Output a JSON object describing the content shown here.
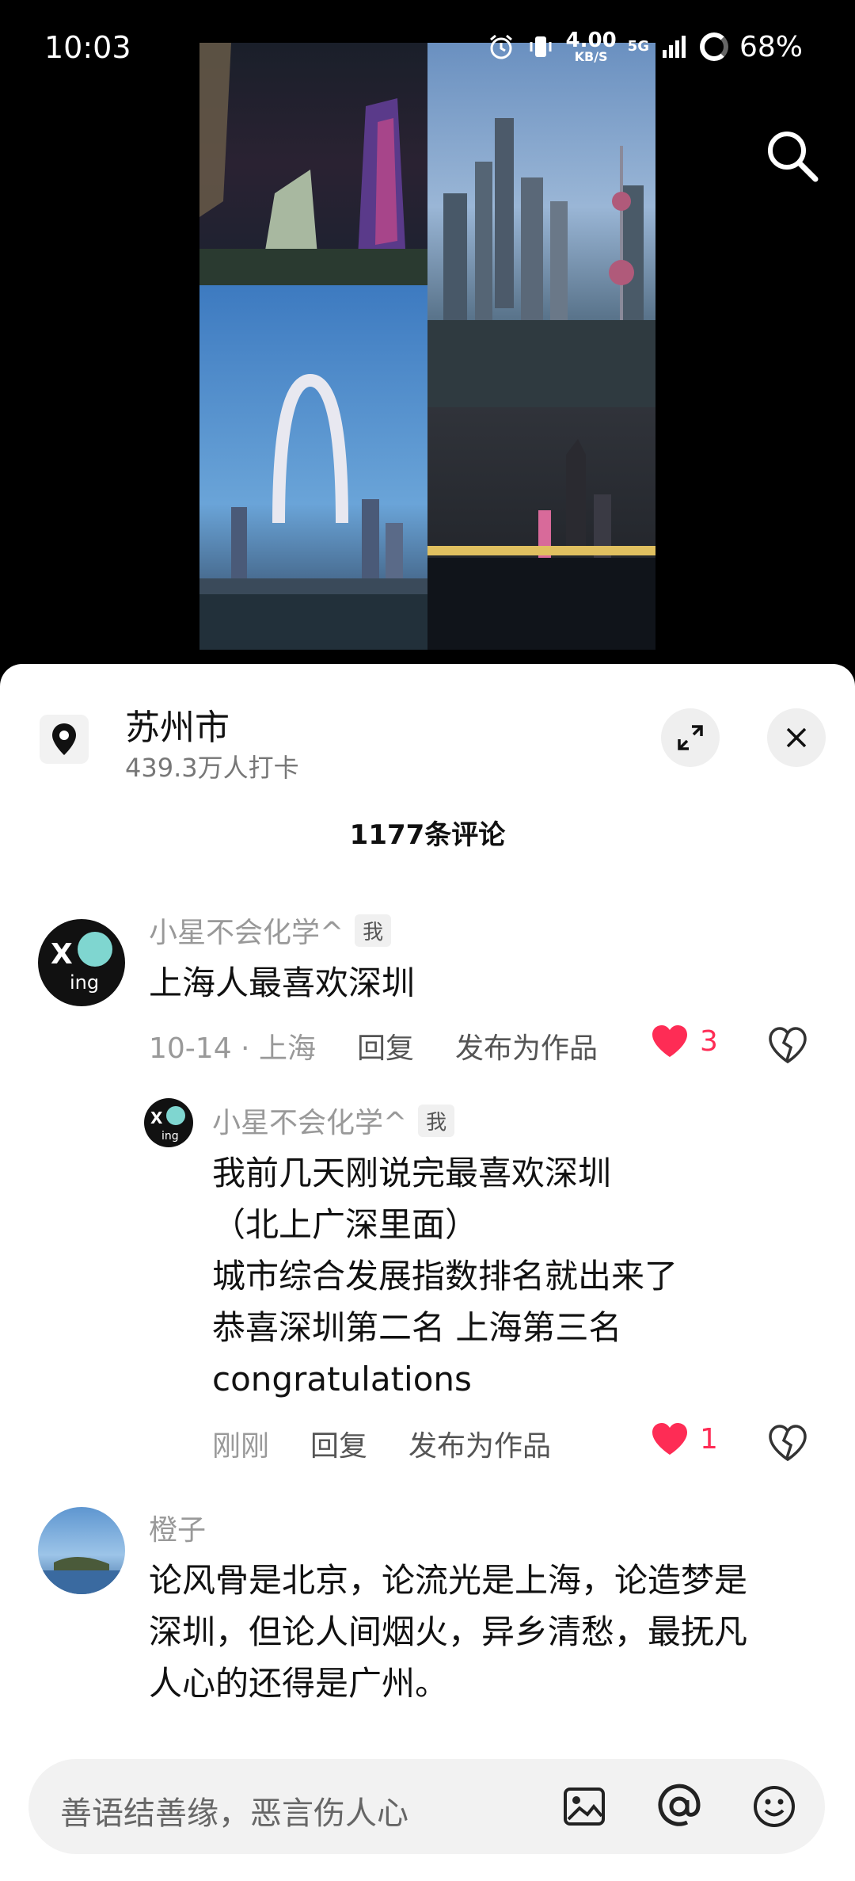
{
  "status_bar": {
    "time": "10:03",
    "net_speed_value": "4.00",
    "net_speed_unit": "KB/S",
    "network_type": "5G",
    "battery": "68%"
  },
  "location": {
    "name": "苏州市",
    "checkins": "439.3万人打卡"
  },
  "comments_title": "1177条评论",
  "comments": [
    {
      "user": "小星不会化学^",
      "badge": "我",
      "text": "上海人最喜欢深圳",
      "date_location": "10-14 · 上海",
      "reply": "回复",
      "publish": "发布为作品",
      "likes": "3"
    },
    {
      "user": "小星不会化学^",
      "badge": "我",
      "lines": [
        "我前几天刚说完最喜欢深圳",
        "（北上广深里面）",
        "城市综合发展指数排名就出来了",
        "恭喜深圳第二名 上海第三名",
        "congratulations"
      ],
      "time": "刚刚",
      "reply": "回复",
      "publish": "发布为作品",
      "likes": "1"
    },
    {
      "user": "橙子",
      "lines": [
        "论风骨是北京，论流光是上海，论造梦是",
        "深圳，但论人间烟火，异乡清愁，最抚凡",
        "人心的还得是广州。"
      ]
    }
  ],
  "input": {
    "placeholder": "善语结善缘，恶言伤人心"
  },
  "colors": {
    "like": "#fe2c55",
    "sheet_bg": "#ffffff",
    "page_bg": "#000000"
  }
}
